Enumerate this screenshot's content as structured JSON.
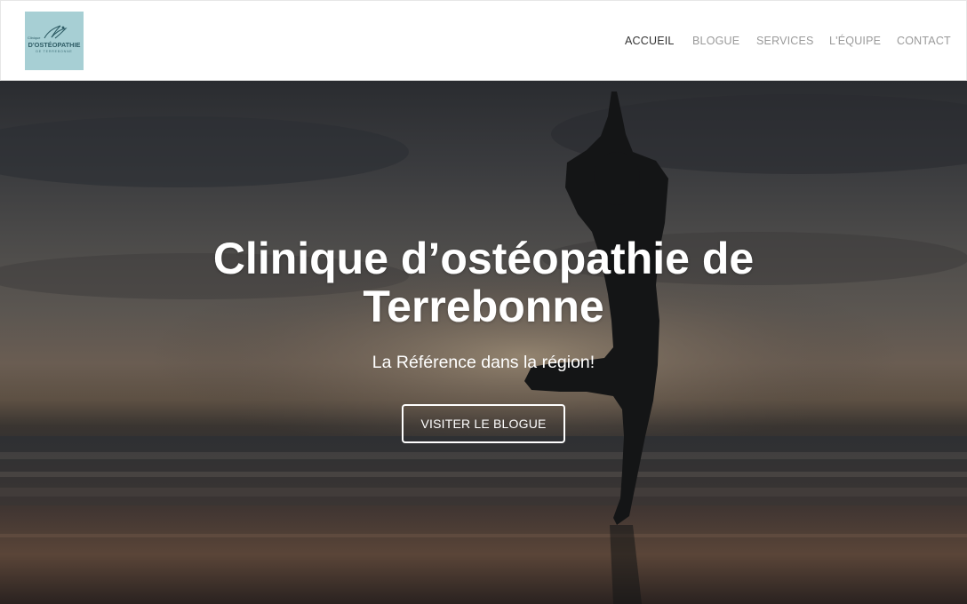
{
  "header": {
    "logo": {
      "small_text": "Clinique",
      "main_text": "D'OSTÉOPATHIE",
      "sub_text": "DE TERREBONNE",
      "background_color": "#a7cfd4"
    },
    "nav": [
      {
        "label": "ACCUEIL",
        "active": true
      },
      {
        "label": "BLOGUE",
        "active": false
      },
      {
        "label": "SERVICES",
        "active": false
      },
      {
        "label": "L'ÉQUIPE",
        "active": false
      },
      {
        "label": "CONTACT",
        "active": false
      }
    ]
  },
  "hero": {
    "title_line1": "Clinique d’ostéopathie de",
    "title_line2": "Terrebonne",
    "subtitle": "La Référence dans la région!",
    "button_label": "VISITER LE BLOGUE",
    "image": "yoga-silhouette-sunset-beach"
  },
  "colors": {
    "nav_active": "#333333",
    "nav_inactive": "#9a9a9a",
    "hero_text": "#ffffff"
  }
}
